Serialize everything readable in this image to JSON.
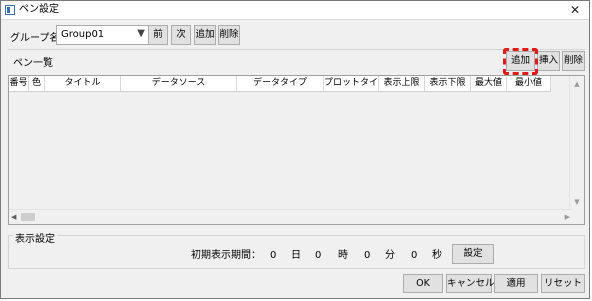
{
  "window": {
    "title": "ペン設定",
    "close_glyph": "✕"
  },
  "group": {
    "label": "グループ名",
    "selected_value": "Group01",
    "dropdown_glyph": "▼",
    "prev_label": "前",
    "next_label": "次",
    "add_label": "追加",
    "delete_label": "削除"
  },
  "pen_list": {
    "label": "ペン一覧",
    "add_label": "追加",
    "insert_label": "挿入",
    "delete_label": "削除",
    "columns": [
      "番号",
      "色",
      "タイトル",
      "データソース",
      "データタイプ",
      "プロットタイプ",
      "表示上限",
      "表示下限",
      "最大値",
      "最小値"
    ],
    "rows": [],
    "scroll_up_glyph": "▲",
    "scroll_down_glyph": "▼",
    "scroll_left_glyph": "◀",
    "scroll_right_glyph": "▶"
  },
  "display_settings": {
    "legend": "表示設定",
    "initial_period_label": "初期表示期間：",
    "days_value": "0",
    "days_unit": "日",
    "hours_value": "0",
    "hours_unit": "時",
    "minutes_value": "0",
    "minutes_unit": "分",
    "seconds_value": "0",
    "seconds_unit": "秒",
    "set_label": "設定"
  },
  "footer": {
    "ok_label": "OK",
    "cancel_label": "キャンセル",
    "apply_label": "適用",
    "reset_label": "リセット"
  },
  "colors": {
    "highlight": "#e21a1a",
    "window_bg": "#f0f0f0",
    "button_bg": "#e1e1e1"
  }
}
